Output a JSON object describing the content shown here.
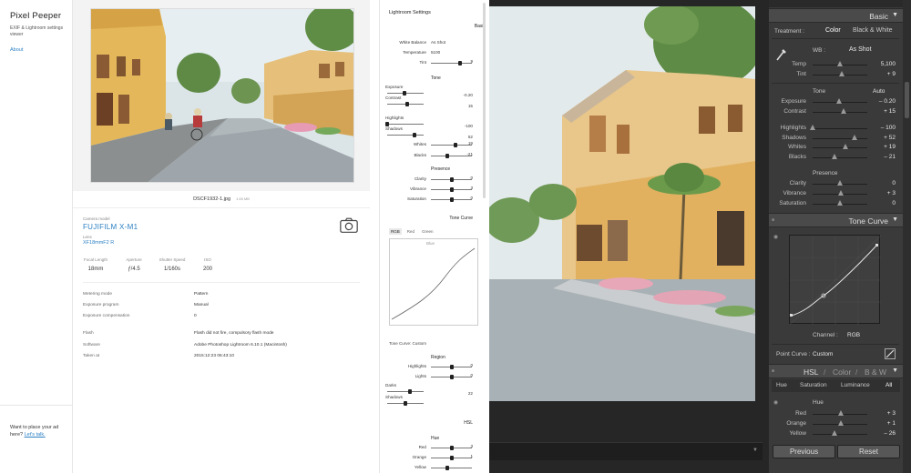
{
  "site": {
    "brand": "Pixel Peeper",
    "tagline": "EXIF & Lightroom settings viewer",
    "about": "About",
    "ad_text": "Want to place your ad here?",
    "ad_link": "Let's talk."
  },
  "photo": {
    "filename": "DSCF1932-1.jpg",
    "filesize": "1.65 MB",
    "camera_label": "Camera model",
    "camera": "FUJIFILM X-M1",
    "lens_label": "Lens",
    "lens": "XF18mmF2 R",
    "exif": [
      {
        "label": "Focal Length",
        "value": "18mm"
      },
      {
        "label": "Aperture",
        "value": "ƒ/4.5"
      },
      {
        "label": "Shutter Speed",
        "value": "1/160s"
      },
      {
        "label": "ISO",
        "value": "200"
      }
    ],
    "details": [
      {
        "label": "Metering mode",
        "value": "Pattern"
      },
      {
        "label": "Exposure program",
        "value": "Manual"
      },
      {
        "label": "Exposure compensation",
        "value": "0"
      },
      {
        "label": "Flash",
        "value": "Flash did not fire, compulsory flash mode"
      },
      {
        "label": "Software",
        "value": "Adobe Photoshop Lightroom 6.10.1 (Macintosh)"
      },
      {
        "label": "Taken at",
        "value": "2015:12:23 06:43:10"
      }
    ]
  },
  "settings": {
    "title": "Lightroom Settings",
    "basic_head": "Basic",
    "basic": [
      {
        "label": "White Balance",
        "value": "As Shot"
      },
      {
        "label": "Temperature",
        "value": "5100"
      },
      {
        "label": "Tint",
        "value": "9",
        "level": 0.72
      }
    ],
    "tone_head": "Tone",
    "tone": [
      {
        "label": "Exposure",
        "value": "-0.20",
        "level": 0.48,
        "split": true
      },
      {
        "label": "Contrast",
        "value": "15",
        "level": 0.56,
        "split": true
      },
      {
        "label": "Highlights",
        "value": "-100",
        "level": 0.0,
        "split": true
      },
      {
        "label": "Shadows",
        "value": "52",
        "level": 0.76,
        "split": true
      },
      {
        "label": "Whites",
        "value": "19",
        "level": 0.6
      },
      {
        "label": "Blacks",
        "value": "-21",
        "level": 0.4
      }
    ],
    "presence_head": "Presence",
    "presence": [
      {
        "label": "Clarity",
        "value": "0",
        "level": 0.5
      },
      {
        "label": "Vibrance",
        "value": "3",
        "level": 0.52
      },
      {
        "label": "Saturation",
        "value": "0",
        "level": 0.5
      }
    ],
    "tone_curve_head": "Tone Curve",
    "tone_curve_tabs": [
      "RGB",
      "Red",
      "Green",
      "Blue"
    ],
    "tone_curve_note": "Tone Curve: Custom",
    "region_head": "Region",
    "region": [
      {
        "label": "Highlights",
        "value": "0",
        "level": 0.5
      },
      {
        "label": "Lights",
        "value": "0",
        "level": 0.5
      },
      {
        "label": "Darks",
        "value": "22",
        "level": 0.62,
        "split": true
      },
      {
        "label": "Shadows",
        "value": "",
        "level": 0.5,
        "split": true
      }
    ],
    "hsl_head": "HSL",
    "hue_head": "Hue",
    "hue": [
      {
        "label": "Red",
        "value": "3",
        "level": 0.52
      },
      {
        "label": "Orange",
        "value": "1",
        "level": 0.51
      },
      {
        "label": "Yellow",
        "value": "",
        "level": 0.4
      }
    ]
  },
  "lightroom": {
    "basic_title": "Basic",
    "treatment_label": "Treatment :",
    "treatment_color": "Color",
    "treatment_bw": "Black & White",
    "wb_label": "WB :",
    "wb_value": "As Shot",
    "wb_rows": [
      {
        "label": "Temp",
        "value": "5,100",
        "level": 0.5
      },
      {
        "label": "Tint",
        "value": "+ 9",
        "level": 0.53
      }
    ],
    "tone_label": "Tone",
    "auto_label": "Auto",
    "tone_rows": [
      {
        "label": "Exposure",
        "value": "– 0.20",
        "level": 0.48
      },
      {
        "label": "Contrast",
        "value": "+ 15",
        "level": 0.56
      },
      {
        "label": "Highlights",
        "value": "– 100",
        "level": 0.0
      },
      {
        "label": "Shadows",
        "value": "+ 52",
        "level": 0.76
      },
      {
        "label": "Whites",
        "value": "+ 19",
        "level": 0.6
      },
      {
        "label": "Blacks",
        "value": "– 21",
        "level": 0.4
      }
    ],
    "presence_label": "Presence",
    "presence_rows": [
      {
        "label": "Clarity",
        "value": "0",
        "level": 0.5
      },
      {
        "label": "Vibrance",
        "value": "+ 3",
        "level": 0.52
      },
      {
        "label": "Saturation",
        "value": "0",
        "level": 0.5
      }
    ],
    "tone_curve_title": "Tone Curve",
    "channel_label": "Channel :",
    "channel_value": "RGB",
    "point_curve_label": "Point Curve :",
    "point_curve_value": "Custom",
    "hsl_tabs": [
      "HSL",
      "/",
      "Color",
      "/",
      "B & W"
    ],
    "sub_tabs": [
      "Hue",
      "Saturation",
      "Luminance",
      "All"
    ],
    "hue_label": "Hue",
    "hue_rows": [
      {
        "label": "Red",
        "value": "+ 3",
        "level": 0.52
      },
      {
        "label": "Orange",
        "value": "+ 1",
        "level": 0.51
      },
      {
        "label": "Yellow",
        "value": "– 26",
        "level": 0.4
      }
    ],
    "previous": "Previous",
    "reset": "Reset"
  },
  "colors": {
    "link_blue": "#2b7fc3",
    "lr_panel": "#3a3a3a",
    "lr_header": "#4a4a4a"
  }
}
